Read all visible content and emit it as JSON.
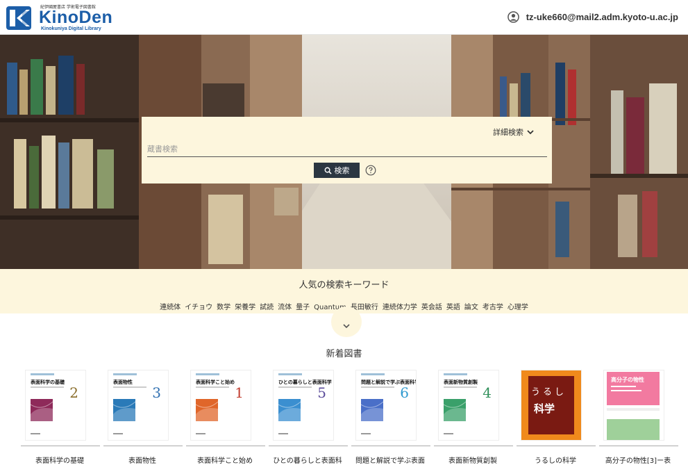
{
  "header": {
    "logo_small": "紀伊國屋書店 学術電子図書館",
    "logo_name": "KinoDen",
    "logo_sub": "Kinokuniya Digital Library",
    "user_email": "tz-uke660@mail2.adm.kyoto-u.ac.jp"
  },
  "search": {
    "advanced_label": "詳細検索",
    "placeholder": "蔵書検索",
    "button_label": "検索"
  },
  "keywords": {
    "title": "人気の検索キーワード",
    "items": [
      "連続体",
      "イチョウ",
      "数学",
      "栄養学",
      "試読",
      "流体",
      "量子",
      "Quantum",
      "長田敏行",
      "連続体力学",
      "英会話",
      "英語",
      "論文",
      "考古学",
      "心理学"
    ]
  },
  "new_books": {
    "title": "新着図書",
    "items": [
      {
        "label": "表面科学の基礎",
        "cover_title": "表面科学の基礎",
        "number": "2",
        "number_color": "#8a6d2a",
        "art_color": "#8e2a5a"
      },
      {
        "label": "表面物性",
        "cover_title": "表面物性",
        "number": "3",
        "number_color": "#2f6fb0",
        "art_color": "#2a7ab8"
      },
      {
        "label": "表面科学こと始め",
        "cover_title": "表面科学こと始め",
        "number": "1",
        "number_color": "#c0392b",
        "art_color": "#e0662a"
      },
      {
        "label": "ひとの暮らしと表面科",
        "cover_title": "ひとの暮らしと表面科学",
        "number": "5",
        "number_color": "#5a4b9a",
        "art_color": "#3b8fd0"
      },
      {
        "label": "問題と解説で学ぶ表面",
        "cover_title": "問題と解説で学ぶ表面科学",
        "number": "6",
        "number_color": "#2f9ad0",
        "art_color": "#4a6fc8"
      },
      {
        "label": "表面新物質創製",
        "cover_title": "表面新物質創製",
        "number": "4",
        "number_color": "#2f8f5a",
        "art_color": "#3aa06a"
      },
      {
        "label": "うるしの科学",
        "cover_title": "うるし",
        "cover_subtitle": "科学"
      },
      {
        "label": "高分子の物性[3]ー表",
        "cover_title": "高分子の物性"
      }
    ]
  }
}
